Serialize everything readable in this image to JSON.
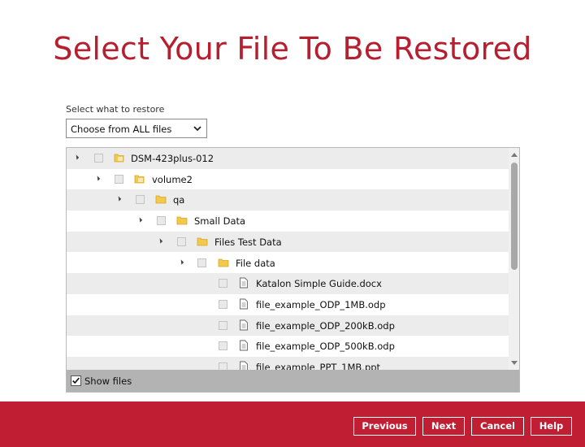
{
  "page": {
    "title": "Select Your File To Be Restored"
  },
  "restore": {
    "label": "Select what to restore",
    "selected": "Choose from ALL files"
  },
  "tree": {
    "rows": [
      {
        "label": "DSM-423plus-012",
        "type": "folder",
        "expanded": true
      },
      {
        "label": "volume2",
        "type": "folder",
        "expanded": true
      },
      {
        "label": "qa",
        "type": "folder",
        "expanded": true
      },
      {
        "label": "Small Data",
        "type": "folder",
        "expanded": true
      },
      {
        "label": "Files Test Data",
        "type": "folder",
        "expanded": true
      },
      {
        "label": "File data",
        "type": "folder",
        "expanded": true
      },
      {
        "label": "Katalon Simple Guide.docx",
        "type": "file"
      },
      {
        "label": "file_example_ODP_1MB.odp",
        "type": "file"
      },
      {
        "label": "file_example_ODP_200kB.odp",
        "type": "file"
      },
      {
        "label": "file_example_ODP_500kB.odp",
        "type": "file"
      },
      {
        "label": "file_example_PPT_1MB.ppt",
        "type": "file"
      }
    ],
    "show_files_label": "Show files",
    "show_files_checked": true
  },
  "footer": {
    "previous": "Previous",
    "next": "Next",
    "cancel": "Cancel",
    "help": "Help"
  },
  "colors": {
    "brand": "#c01f33",
    "title": "#b51f2f",
    "folder": "#f3c94b"
  }
}
